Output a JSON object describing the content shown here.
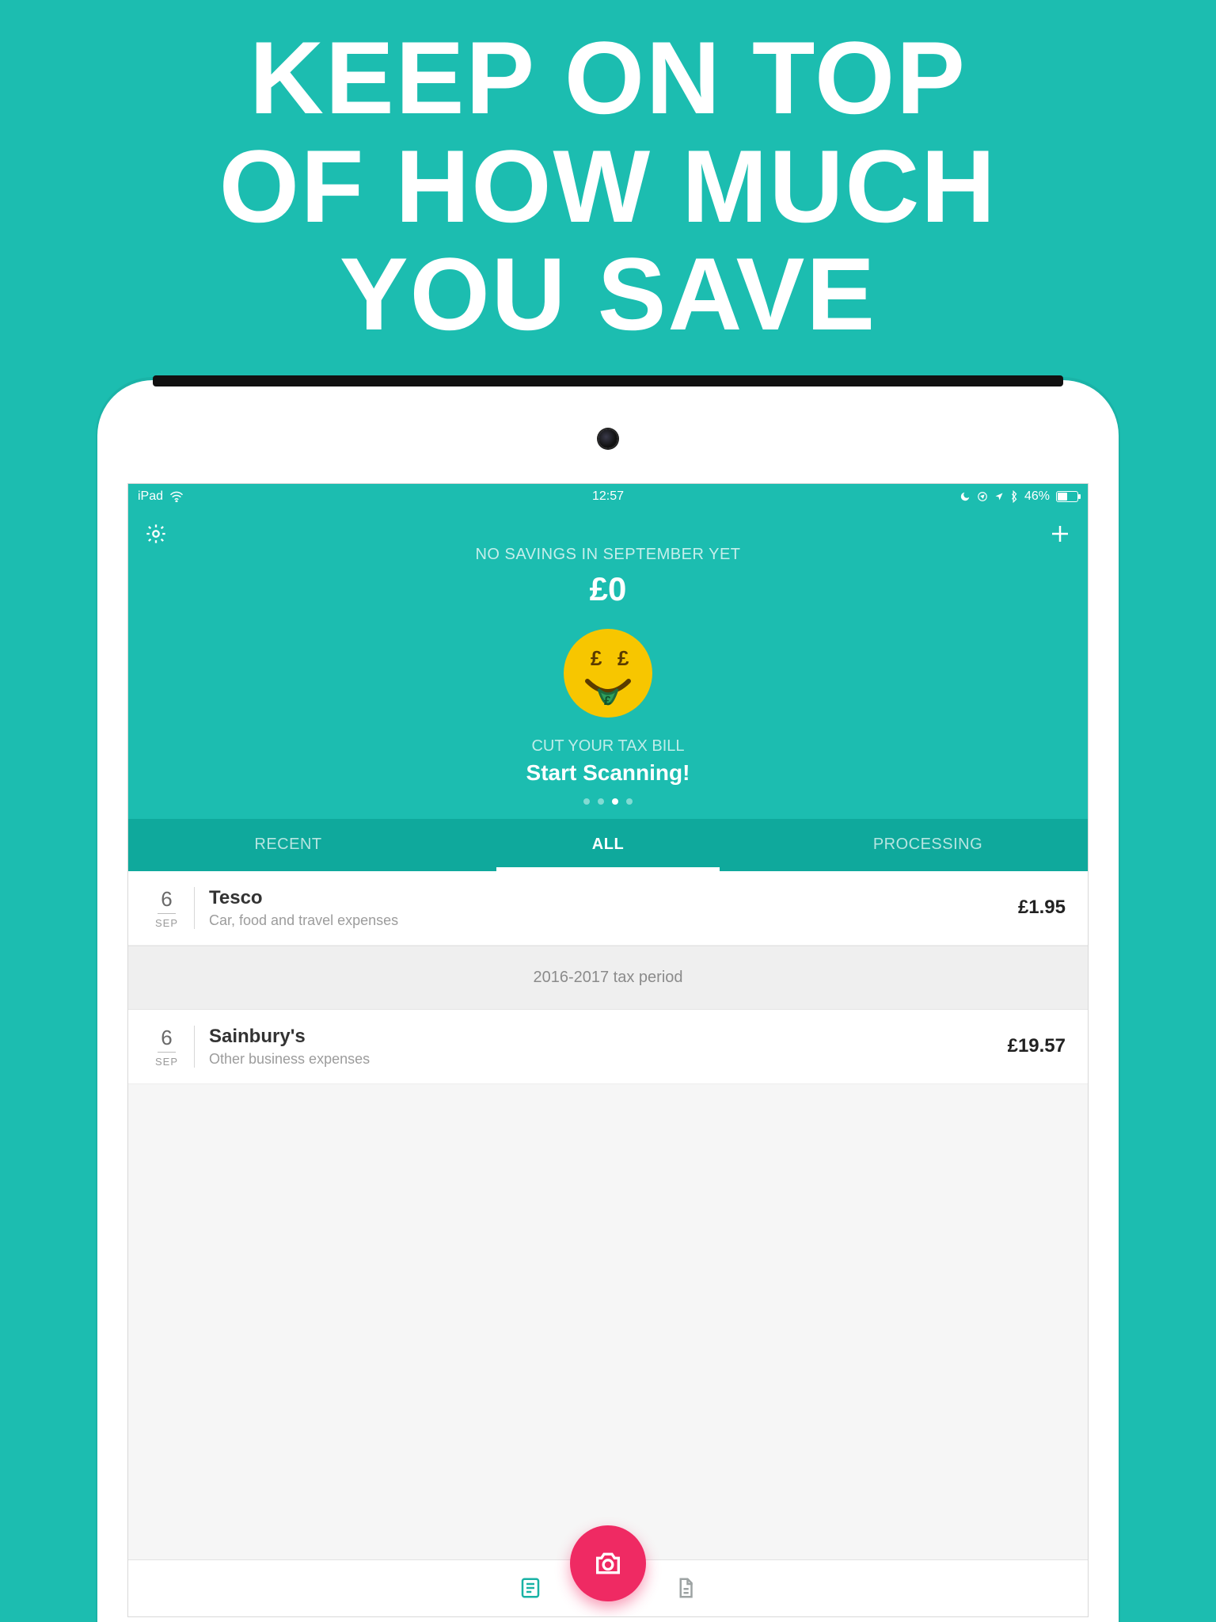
{
  "hero": {
    "line1": "KEEP ON TOP",
    "line2": "OF HOW MUCH",
    "line3": "YOU SAVE"
  },
  "statusbar": {
    "carrier": "iPad",
    "time": "12:57",
    "battery_pct": "46%"
  },
  "header": {
    "savings_label": "NO SAVINGS IN SEPTEMBER YET",
    "savings_amount": "£0",
    "slogan_sub": "CUT YOUR TAX BILL",
    "slogan_main": "Start Scanning!",
    "active_dot_index": 2,
    "dot_count": 4
  },
  "tabs": {
    "items": [
      "RECENT",
      "ALL",
      "PROCESSING"
    ],
    "active_index": 1
  },
  "period_separator": "2016-2017 tax period",
  "rows": [
    {
      "day": "6",
      "mon": "SEP",
      "title": "Tesco",
      "sub": "Car, food and travel expenses",
      "amount": "£1.95"
    },
    {
      "day": "6",
      "mon": "SEP",
      "title": "Sainbury's",
      "sub": "Other business expenses",
      "amount": "£19.57"
    }
  ]
}
